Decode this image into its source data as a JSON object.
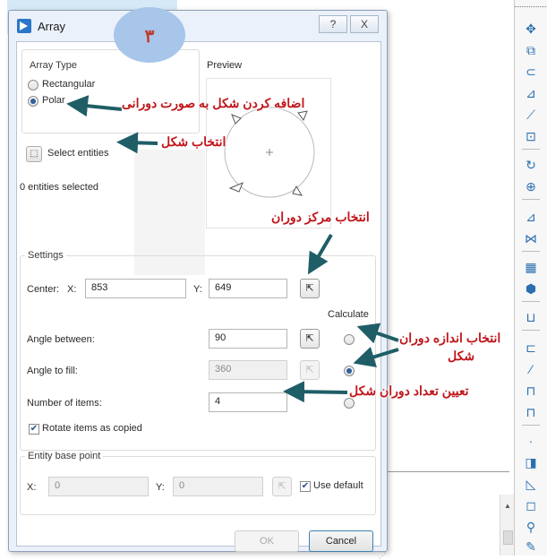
{
  "dialog": {
    "title": "Array",
    "help_button": "?",
    "close_button": "X",
    "array_type": {
      "label": "Array Type",
      "options": [
        "Rectangular",
        "Polar"
      ],
      "selected": "Polar"
    },
    "preview_label": "Preview",
    "select_entities_label": "Select entities",
    "entities_selected_text": "0 entities selected",
    "settings": {
      "label": "Settings",
      "center_label": "Center:",
      "x_label": "X:",
      "x_value": "853",
      "y_label": "Y:",
      "y_value": "649",
      "calculate_label": "Calculate",
      "angle_between_label": "Angle between:",
      "angle_between_value": "90",
      "angle_to_fill_label": "Angle to fill:",
      "angle_to_fill_value": "360",
      "number_of_items_label": "Number of items:",
      "number_of_items_value": "4",
      "rotate_items_label": "Rotate items as copied",
      "rotate_items_checked": true,
      "calculate_selected": "Angle to fill"
    },
    "base_point": {
      "label": "Entity base point",
      "x_label": "X:",
      "x_value": "0",
      "y_label": "Y:",
      "y_value": "0",
      "use_default_label": "Use default",
      "use_default_checked": true
    },
    "ok_label": "OK",
    "cancel_label": "Cancel"
  },
  "annotations": {
    "badge_number": "۳",
    "polar_note": "اضافه کردن شکل به صورت دورانی",
    "select_note": "انتخاب شکل",
    "center_note": "انتخاب مرکز دوران",
    "angle_note_line1": "انتخاب اندازه دوران",
    "angle_note_line2": "شکل",
    "items_note": "تعیین تعداد دوران شکل"
  },
  "colors": {
    "annotation_text": "#c0161b",
    "arrow": "#1f5e66",
    "badge": "#a8c6ea",
    "dialog_frame": "#eaf1fa"
  },
  "toolbar_icons": [
    "move-icon",
    "copy-icon",
    "offset-icon",
    "trim-icon",
    "extend-icon",
    "fillet-icon",
    "rotate-icon",
    "mirror-axis-icon",
    "mirror-icon",
    "mirror-copy-icon",
    "array-icon",
    "explode-icon",
    "divide-icon",
    "measure-icon",
    "break-icon",
    "join-icon",
    "lengthen-icon",
    "stretch-icon",
    "chamfer-icon",
    "scale-icon",
    "polyline-icon",
    "edit-icon"
  ]
}
